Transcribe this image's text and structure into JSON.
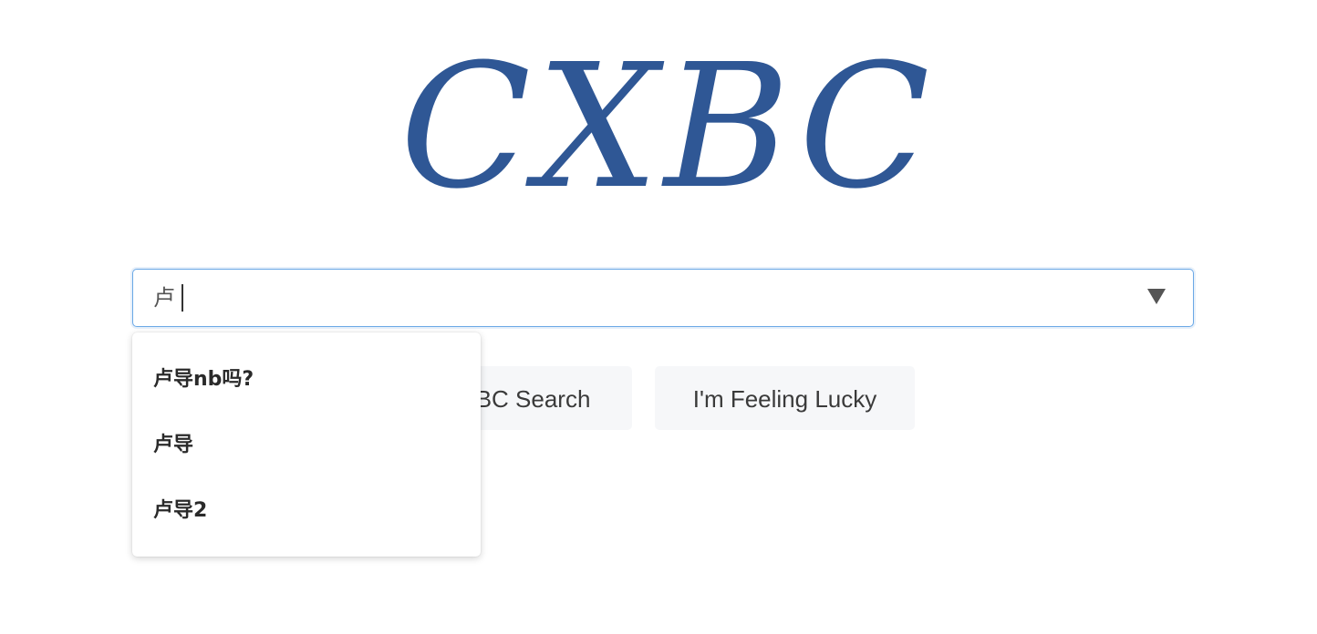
{
  "logo": {
    "text": "CXBC",
    "color": "#2f5795"
  },
  "search": {
    "value": "卢",
    "dropdown_icon": "triangle-down-icon"
  },
  "buttons": {
    "search_label": "CXBC Search",
    "lucky_label": "I'm Feeling Lucky"
  },
  "suggestions": [
    {
      "label": "卢导nb吗?"
    },
    {
      "label": "卢导"
    },
    {
      "label": "卢导2"
    }
  ]
}
